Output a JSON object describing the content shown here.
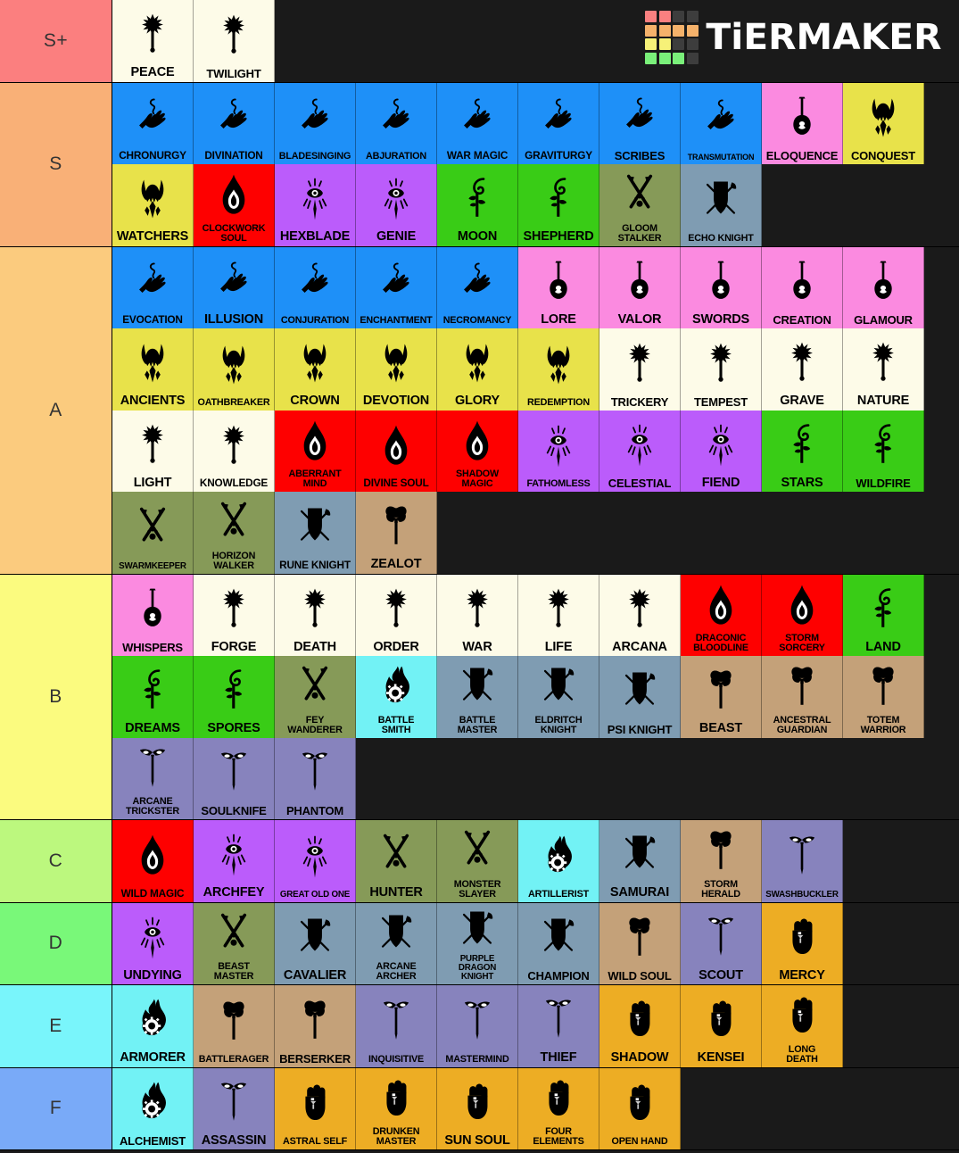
{
  "brand": {
    "name": "TiERMAKER",
    "logo_grid_colors": [
      "#f98080",
      "#f98080",
      "#3d3d3d",
      "#3d3d3d",
      "#f5b26b",
      "#f5b26b",
      "#f5b26b",
      "#f5b26b",
      "#f6f178",
      "#f6f178",
      "#3d3d3d",
      "#3d3d3d",
      "#7af07a",
      "#7af07a",
      "#7af07a",
      "#3d3d3d"
    ]
  },
  "palette": {
    "wizard": "#1e90f8",
    "bard": "#fb8ae0",
    "paladin": "#e8e24a",
    "cleric": "#fdfbe8",
    "sorcerer": "#fe0000",
    "warlock": "#bb5cfb",
    "druid": "#39cc16",
    "ranger": "#869a58",
    "fighter": "#7f9cb2",
    "barbarian": "#c4a179",
    "rogue": "#8783bd",
    "artificer": "#72f2f5",
    "monk": "#edad24",
    "background": "#1a1a1a"
  },
  "tiers": [
    {
      "label": "S+",
      "color": "#fb7f7f",
      "items": [
        {
          "name": "PEACE",
          "cls": "cleric",
          "size": "s14"
        },
        {
          "name": "TWILIGHT",
          "cls": "cleric",
          "size": "s13"
        }
      ]
    },
    {
      "label": "S",
      "color": "#f9b077",
      "items": [
        {
          "name": "CHRONURGY",
          "cls": "wizard",
          "size": "s12"
        },
        {
          "name": "DIVINATION",
          "cls": "wizard",
          "size": "s12"
        },
        {
          "name": "BLADESINGING",
          "cls": "wizard",
          "size": "s11"
        },
        {
          "name": "ABJURATION",
          "cls": "wizard",
          "size": "s11"
        },
        {
          "name": "WAR MAGIC",
          "cls": "wizard",
          "size": "s12"
        },
        {
          "name": "GRAVITURGY",
          "cls": "wizard",
          "size": "s12"
        },
        {
          "name": "SCRIBES",
          "cls": "wizard",
          "size": "s13"
        },
        {
          "name": "TRANSMUTATION",
          "cls": "wizard",
          "size": "s9"
        },
        {
          "name": "ELOQUENCE",
          "cls": "bard",
          "size": "s13"
        },
        {
          "name": "CONQUEST",
          "cls": "paladin",
          "size": "s13"
        },
        {
          "name": "WATCHERS",
          "cls": "paladin",
          "size": "s14"
        },
        {
          "name": "CLOCKWORK SOUL",
          "cls": "sorcerer",
          "size": "s11",
          "two": true
        },
        {
          "name": "HEXBLADE",
          "cls": "warlock",
          "size": "s14"
        },
        {
          "name": "GENIE",
          "cls": "warlock",
          "size": "s14"
        },
        {
          "name": "MOON",
          "cls": "druid",
          "size": "s14"
        },
        {
          "name": "SHEPHERD",
          "cls": "druid",
          "size": "s14"
        },
        {
          "name": "GLOOM STALKER",
          "cls": "ranger",
          "size": "s11",
          "two": true
        },
        {
          "name": "ECHO KNIGHT",
          "cls": "fighter",
          "size": "s11"
        }
      ]
    },
    {
      "label": "A",
      "color": "#fbcb7e",
      "items": [
        {
          "name": "EVOCATION",
          "cls": "wizard",
          "size": "s12"
        },
        {
          "name": "ILLUSION",
          "cls": "wizard",
          "size": "s14"
        },
        {
          "name": "CONJURATION",
          "cls": "wizard",
          "size": "s11"
        },
        {
          "name": "ENCHANTMENT",
          "cls": "wizard",
          "size": "s11"
        },
        {
          "name": "NECROMANCY",
          "cls": "wizard",
          "size": "s11"
        },
        {
          "name": "LORE",
          "cls": "bard",
          "size": "s14"
        },
        {
          "name": "VALOR",
          "cls": "bard",
          "size": "s14"
        },
        {
          "name": "SWORDS",
          "cls": "bard",
          "size": "s14"
        },
        {
          "name": "CREATION",
          "cls": "bard",
          "size": "s13"
        },
        {
          "name": "GLAMOUR",
          "cls": "bard",
          "size": "s13"
        },
        {
          "name": "ANCIENTS",
          "cls": "paladin",
          "size": "s14"
        },
        {
          "name": "OATHBREAKER",
          "cls": "paladin",
          "size": "s11"
        },
        {
          "name": "CROWN",
          "cls": "paladin",
          "size": "s14"
        },
        {
          "name": "DEVOTION",
          "cls": "paladin",
          "size": "s14"
        },
        {
          "name": "GLORY",
          "cls": "paladin",
          "size": "s14"
        },
        {
          "name": "REDEMPTION",
          "cls": "paladin",
          "size": "s11"
        },
        {
          "name": "TRICKERY",
          "cls": "cleric",
          "size": "s13"
        },
        {
          "name": "TEMPEST",
          "cls": "cleric",
          "size": "s13"
        },
        {
          "name": "GRAVE",
          "cls": "cleric",
          "size": "s14"
        },
        {
          "name": "NATURE",
          "cls": "cleric",
          "size": "s14"
        },
        {
          "name": "LIGHT",
          "cls": "cleric",
          "size": "s14"
        },
        {
          "name": "KNOWLEDGE",
          "cls": "cleric",
          "size": "s12"
        },
        {
          "name": "ABERRANT MIND",
          "cls": "sorcerer",
          "size": "s11",
          "two": true
        },
        {
          "name": "DIVINE SOUL",
          "cls": "sorcerer",
          "size": "s12"
        },
        {
          "name": "SHADOW MAGIC",
          "cls": "sorcerer",
          "size": "s11",
          "two": true
        },
        {
          "name": "FATHOMLESS",
          "cls": "warlock",
          "size": "s11"
        },
        {
          "name": "CELESTIAL",
          "cls": "warlock",
          "size": "s13"
        },
        {
          "name": "FIEND",
          "cls": "warlock",
          "size": "s14"
        },
        {
          "name": "STARS",
          "cls": "druid",
          "size": "s14"
        },
        {
          "name": "WILDFIRE",
          "cls": "druid",
          "size": "s13"
        },
        {
          "name": "SWARMKEEPER",
          "cls": "ranger",
          "size": "s10"
        },
        {
          "name": "HORIZON WALKER",
          "cls": "ranger",
          "size": "s11",
          "two": true
        },
        {
          "name": "RUNE KNIGHT",
          "cls": "fighter",
          "size": "s12"
        },
        {
          "name": "ZEALOT",
          "cls": "barbarian",
          "size": "s14"
        }
      ]
    },
    {
      "label": "B",
      "color": "#fbfb7f",
      "items": [
        {
          "name": "WHISPERS",
          "cls": "bard",
          "size": "s13"
        },
        {
          "name": "FORGE",
          "cls": "cleric",
          "size": "s14"
        },
        {
          "name": "DEATH",
          "cls": "cleric",
          "size": "s14"
        },
        {
          "name": "ORDER",
          "cls": "cleric",
          "size": "s14"
        },
        {
          "name": "WAR",
          "cls": "cleric",
          "size": "s14"
        },
        {
          "name": "LIFE",
          "cls": "cleric",
          "size": "s14"
        },
        {
          "name": "ARCANA",
          "cls": "cleric",
          "size": "s14"
        },
        {
          "name": "DRACONIC BLOODLINE",
          "cls": "sorcerer",
          "size": "s11",
          "two": true
        },
        {
          "name": "STORM SORCERY",
          "cls": "sorcerer",
          "size": "s11",
          "two": true
        },
        {
          "name": "LAND",
          "cls": "druid",
          "size": "s14"
        },
        {
          "name": "DREAMS",
          "cls": "druid",
          "size": "s14"
        },
        {
          "name": "SPORES",
          "cls": "druid",
          "size": "s14"
        },
        {
          "name": "FEY WANDERER",
          "cls": "ranger",
          "size": "s11",
          "two": true
        },
        {
          "name": "BATTLE SMITH",
          "cls": "artificer",
          "size": "s11",
          "two": true
        },
        {
          "name": "BATTLE MASTER",
          "cls": "fighter",
          "size": "s11",
          "two": true
        },
        {
          "name": "ELDRITCH KNIGHT",
          "cls": "fighter",
          "size": "s11",
          "two": true
        },
        {
          "name": "PSI KNIGHT",
          "cls": "fighter",
          "size": "s13"
        },
        {
          "name": "BEAST",
          "cls": "barbarian",
          "size": "s14"
        },
        {
          "name": "ANCESTRAL GUARDIAN",
          "cls": "barbarian",
          "size": "s11",
          "two": true
        },
        {
          "name": "TOTEM WARRIOR",
          "cls": "barbarian",
          "size": "s11",
          "two": true
        },
        {
          "name": "ARCANE TRICKSTER",
          "cls": "rogue",
          "size": "s11",
          "two": true
        },
        {
          "name": "SOULKNIFE",
          "cls": "rogue",
          "size": "s13"
        },
        {
          "name": "PHANTOM",
          "cls": "rogue",
          "size": "s13"
        }
      ]
    },
    {
      "label": "C",
      "color": "#bcf87e",
      "items": [
        {
          "name": "WILD MAGIC",
          "cls": "sorcerer",
          "size": "s12"
        },
        {
          "name": "ARCHFEY",
          "cls": "warlock",
          "size": "s14"
        },
        {
          "name": "GREAT OLD ONE",
          "cls": "warlock",
          "size": "s10"
        },
        {
          "name": "HUNTER",
          "cls": "ranger",
          "size": "s14"
        },
        {
          "name": "MONSTER SLAYER",
          "cls": "ranger",
          "size": "s11",
          "two": true
        },
        {
          "name": "ARTILLERIST",
          "cls": "artificer",
          "size": "s11"
        },
        {
          "name": "SAMURAI",
          "cls": "fighter",
          "size": "s14"
        },
        {
          "name": "STORM HERALD",
          "cls": "barbarian",
          "size": "s11",
          "two": true
        },
        {
          "name": "SWASHBUCKLER",
          "cls": "rogue",
          "size": "s10"
        }
      ]
    },
    {
      "label": "D",
      "color": "#79f879",
      "items": [
        {
          "name": "UNDYING",
          "cls": "warlock",
          "size": "s14"
        },
        {
          "name": "BEAST MASTER",
          "cls": "ranger",
          "size": "s11",
          "two": true
        },
        {
          "name": "CAVALIER",
          "cls": "fighter",
          "size": "s14"
        },
        {
          "name": "ARCANE ARCHER",
          "cls": "fighter",
          "size": "s11",
          "two": true
        },
        {
          "name": "PURPLE DRAGON KNIGHT",
          "cls": "fighter",
          "size": "s10",
          "two": true
        },
        {
          "name": "CHAMPION",
          "cls": "fighter",
          "size": "s13"
        },
        {
          "name": "WILD SOUL",
          "cls": "barbarian",
          "size": "s13"
        },
        {
          "name": "SCOUT",
          "cls": "rogue",
          "size": "s14"
        },
        {
          "name": "MERCY",
          "cls": "monk",
          "size": "s14"
        }
      ]
    },
    {
      "label": "E",
      "color": "#79f5fb",
      "items": [
        {
          "name": "ARMORER",
          "cls": "artificer",
          "size": "s14"
        },
        {
          "name": "BATTLERAGER",
          "cls": "barbarian",
          "size": "s11"
        },
        {
          "name": "BERSERKER",
          "cls": "barbarian",
          "size": "s13"
        },
        {
          "name": "INQUISITIVE",
          "cls": "rogue",
          "size": "s11"
        },
        {
          "name": "MASTERMIND",
          "cls": "rogue",
          "size": "s11"
        },
        {
          "name": "THIEF",
          "cls": "rogue",
          "size": "s14"
        },
        {
          "name": "SHADOW",
          "cls": "monk",
          "size": "s14"
        },
        {
          "name": "KENSEI",
          "cls": "monk",
          "size": "s14"
        },
        {
          "name": "LONG DEATH",
          "cls": "monk",
          "size": "s11",
          "two": true
        }
      ]
    },
    {
      "label": "F",
      "color": "#79aaf8",
      "items": [
        {
          "name": "ALCHEMIST",
          "cls": "artificer",
          "size": "s13"
        },
        {
          "name": "ASSASSIN",
          "cls": "rogue",
          "size": "s14"
        },
        {
          "name": "ASTRAL SELF",
          "cls": "monk",
          "size": "s11"
        },
        {
          "name": "DRUNKEN MASTER",
          "cls": "monk",
          "size": "s11",
          "two": true
        },
        {
          "name": "SUN SOUL",
          "cls": "monk",
          "size": "s14"
        },
        {
          "name": "FOUR ELEMENTS",
          "cls": "monk",
          "size": "s11",
          "two": true
        },
        {
          "name": "OPEN HAND",
          "cls": "monk",
          "size": "s11"
        }
      ]
    }
  ]
}
